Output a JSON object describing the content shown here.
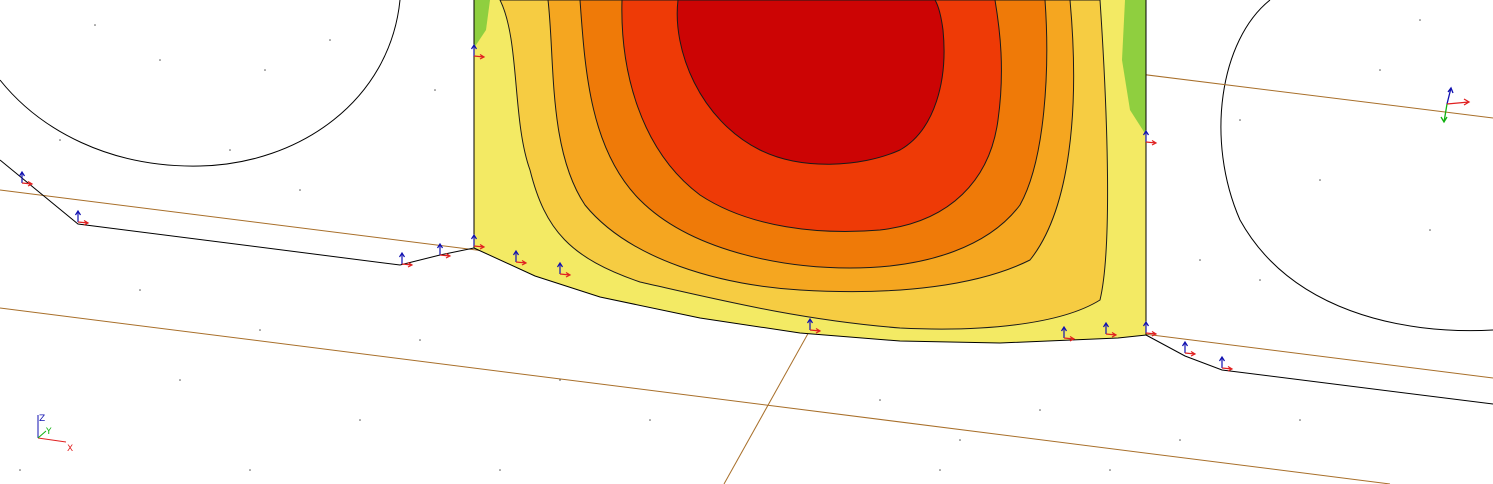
{
  "viewport": {
    "background": "#ffffff"
  },
  "contour_plot": {
    "bands": [
      {
        "level": 0,
        "color": "#8fcf3f"
      },
      {
        "level": 1,
        "color": "#f3ea64"
      },
      {
        "level": 2,
        "color": "#f6cc42"
      },
      {
        "level": 3,
        "color": "#f5a620"
      },
      {
        "level": 4,
        "color": "#ef7a08"
      },
      {
        "level": 5,
        "color": "#ee3a06"
      },
      {
        "level": 6,
        "color": "#cc0404"
      }
    ],
    "isoline_color": "#1a1a1a"
  },
  "geometry": {
    "outline_color": "#000000",
    "guide_line_color": "#a86f2a"
  },
  "support_markers": {
    "z_arrow_color": "#1010b0",
    "x_arrow_color": "#e02020",
    "y_arrow_color": "#10b010"
  },
  "axis_triad": {
    "x_label": "X",
    "y_label": "Y",
    "z_label": "Z",
    "x_color": "#e02020",
    "y_color": "#10b010",
    "z_color": "#1010b0"
  }
}
